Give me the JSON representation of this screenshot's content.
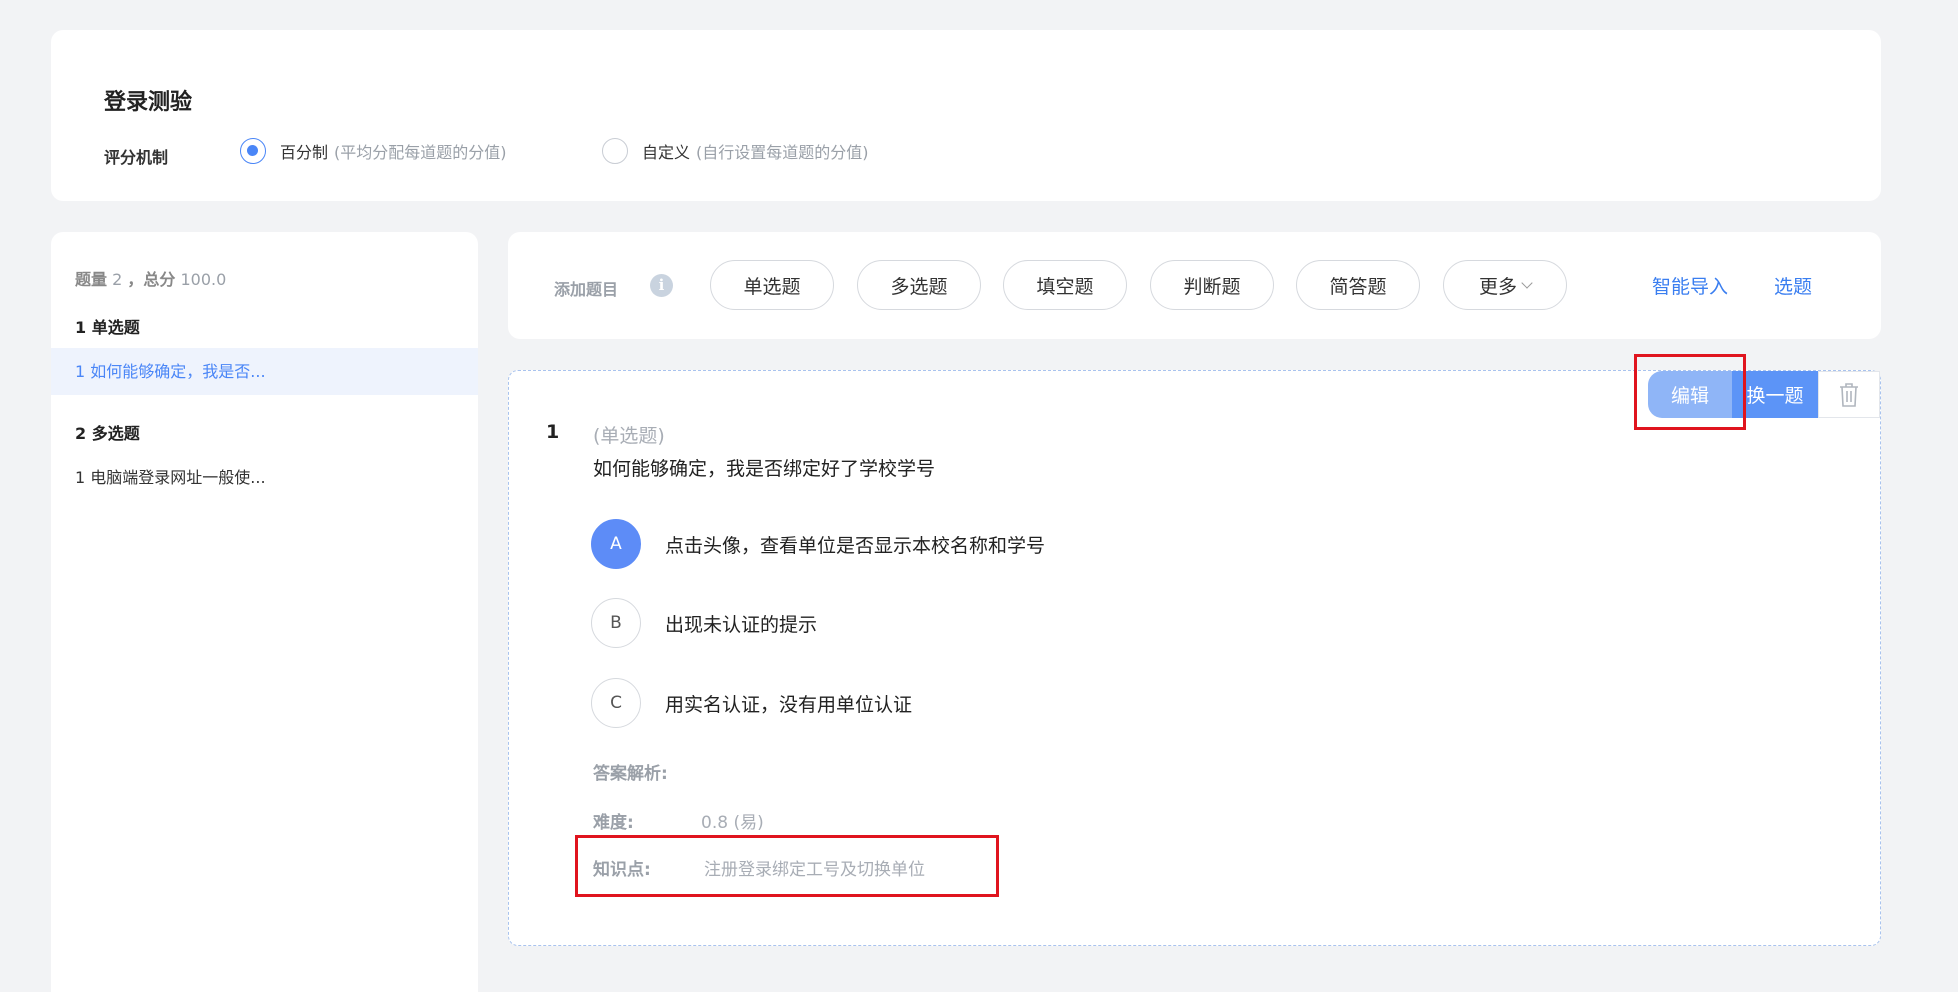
{
  "header": {
    "title": "登录测验",
    "scoring_label": "评分机制",
    "options": [
      {
        "label": "百分制",
        "hint": "(平均分配每道题的分值)",
        "checked": true
      },
      {
        "label": "自定义",
        "hint": "(自行设置每道题的分值)",
        "checked": false
      }
    ]
  },
  "sidebar": {
    "count_label": "题量",
    "count_value": "2",
    "total_label": "，总分",
    "total_value": "100.0",
    "sections": [
      {
        "title": "1 单选题",
        "items": [
          {
            "label": "1 如何能够确定，我是否...",
            "active": true
          }
        ]
      },
      {
        "title": "2 多选题",
        "items": [
          {
            "label": "1 电脑端登录网址一般使...",
            "active": false
          }
        ]
      }
    ]
  },
  "toolbar": {
    "add_label": "添加题目",
    "info_icon": "i",
    "types": [
      "单选题",
      "多选题",
      "填空题",
      "判断题",
      "简答题",
      "更多"
    ],
    "smart_import": "智能导入",
    "pick_question": "选题"
  },
  "question": {
    "number": "1",
    "type": "(单选题)",
    "text": "如何能够确定，我是否绑定好了学校学号",
    "actions": {
      "edit": "编辑",
      "swap": "换一题",
      "delete_icon": "trash-icon"
    },
    "options": [
      {
        "letter": "A",
        "text": "点击头像，查看单位是否显示本校名称和学号",
        "correct": true
      },
      {
        "letter": "B",
        "text": "出现未认证的提示",
        "correct": false
      },
      {
        "letter": "C",
        "text": "用实名认证，没有用单位认证",
        "correct": false
      }
    ],
    "analysis_label": "答案解析:",
    "difficulty_label": "难度:",
    "difficulty_value": "0.8 (易)",
    "knowledge_label": "知识点:",
    "knowledge_value": "注册登录绑定工号及切换单位"
  },
  "colors": {
    "accent": "#4a86f7",
    "highlight": "#e0141e",
    "correct": "#5d8cf7"
  }
}
